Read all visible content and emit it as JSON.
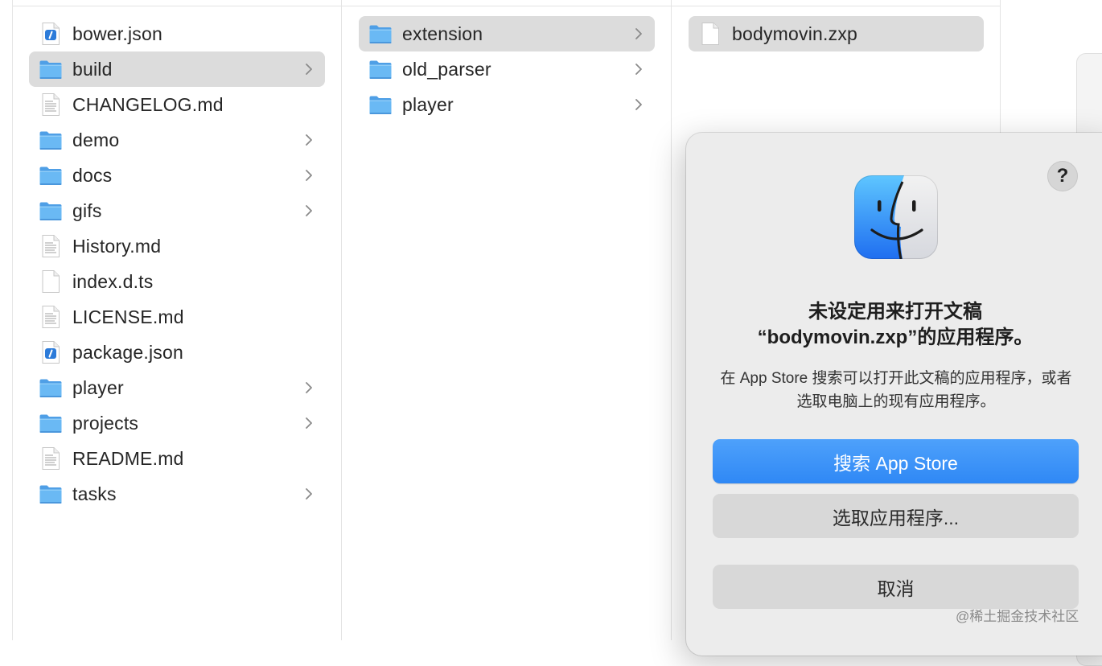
{
  "columns": [
    {
      "items": [
        {
          "name": "bower.json",
          "kind": "json",
          "arrow": false,
          "selected": false
        },
        {
          "name": "build",
          "kind": "folder",
          "arrow": true,
          "selected": true
        },
        {
          "name": "CHANGELOG.md",
          "kind": "text",
          "arrow": false,
          "selected": false
        },
        {
          "name": "demo",
          "kind": "folder",
          "arrow": true,
          "selected": false
        },
        {
          "name": "docs",
          "kind": "folder",
          "arrow": true,
          "selected": false
        },
        {
          "name": "gifs",
          "kind": "folder",
          "arrow": true,
          "selected": false
        },
        {
          "name": "History.md",
          "kind": "text",
          "arrow": false,
          "selected": false
        },
        {
          "name": "index.d.ts",
          "kind": "blank",
          "arrow": false,
          "selected": false
        },
        {
          "name": "LICENSE.md",
          "kind": "text",
          "arrow": false,
          "selected": false
        },
        {
          "name": "package.json",
          "kind": "json",
          "arrow": false,
          "selected": false
        },
        {
          "name": "player",
          "kind": "folder",
          "arrow": true,
          "selected": false
        },
        {
          "name": "projects",
          "kind": "folder",
          "arrow": true,
          "selected": false
        },
        {
          "name": "README.md",
          "kind": "text",
          "arrow": false,
          "selected": false
        },
        {
          "name": "tasks",
          "kind": "folder",
          "arrow": true,
          "selected": false
        }
      ]
    },
    {
      "items": [
        {
          "name": "extension",
          "kind": "folder",
          "arrow": true,
          "selected": true
        },
        {
          "name": "old_parser",
          "kind": "folder",
          "arrow": true,
          "selected": false
        },
        {
          "name": "player",
          "kind": "folder",
          "arrow": true,
          "selected": false
        }
      ]
    },
    {
      "items": [
        {
          "name": "bodymovin.zxp",
          "kind": "blank",
          "arrow": false,
          "selected": true
        }
      ]
    }
  ],
  "dialog": {
    "help_label": "?",
    "icon": "finder-icon",
    "title_line1": "未设定用来打开文稿",
    "title_line2": "“bodymovin.zxp”的应用程序。",
    "body": "在 App Store 搜索可以打开此文稿的应用程序，或者选取电脑上的现有应用程序。",
    "search_button": "搜索 App Store",
    "choose_button": "选取应用程序...",
    "cancel_button": "取消"
  },
  "watermark": "@稀土掘金技术社区",
  "colors": {
    "accent": "#3a8ff7",
    "folder": "#5aaef0",
    "selection": "#dcdcdc",
    "dialog_bg": "#ececec"
  }
}
